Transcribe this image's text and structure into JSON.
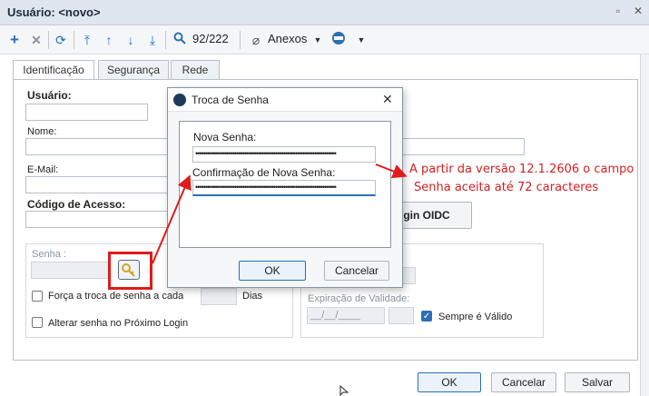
{
  "window": {
    "title": "Usuário: <novo>",
    "controls": [
      "▫",
      "✕"
    ]
  },
  "toolbar": {
    "record_position": "92/222",
    "anexos_label": "Anexos"
  },
  "tabs": [
    "Identificação",
    "Segurança",
    "Rede"
  ],
  "form": {
    "usuario_label": "Usuário:",
    "nome_label": "Nome:",
    "email_label": "E-Mail:",
    "codigo_label": "Código de Acesso:",
    "senha_label": "Senha :",
    "forca_troca_label": "Força a troca de senha a cada",
    "dias_label": "Dias",
    "alterar_label": "Alterar senha no Próximo Login",
    "login_oidc_label": "gin OIDC",
    "expiracao_label": "Expiração de Validade:",
    "expiracao_value": "__/__/____",
    "sempre_valido_label": "Sempre é Válido",
    "sempre_valido_checked": true
  },
  "footer": {
    "ok": "OK",
    "cancelar": "Cancelar",
    "salvar": "Salvar"
  },
  "dialog": {
    "title": "Troca de Senha",
    "nova_senha_label": "Nova Senha:",
    "nova_senha_value": "••••••••••••••••••••••••••••••••••••••••••••••••••••••••••••••••••••••••",
    "confirmacao_label": "Confirmação de Nova Senha:",
    "confirmacao_value": "••••••••••••••••••••••••••••••••••••••••••••••••••••••••••••••••••••••••",
    "ok": "OK",
    "cancelar": "Cancelar"
  },
  "annotation": {
    "line1": "A partir da versão 12.1.2606 o campo",
    "line2": "Senha aceita até 72 caracteres",
    "color": "#d41f1f"
  }
}
